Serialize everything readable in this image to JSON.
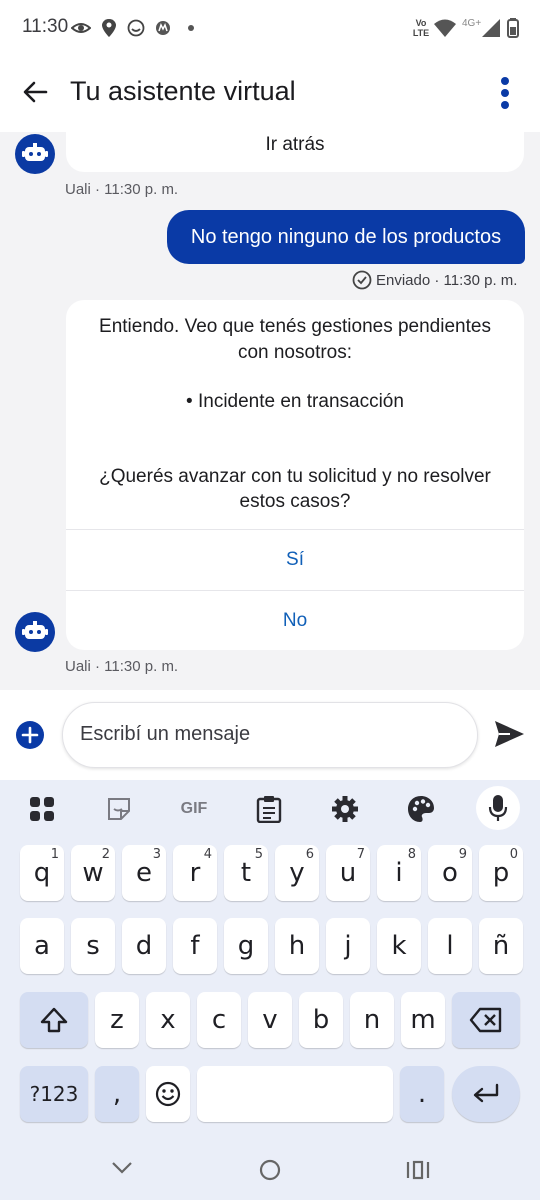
{
  "status_bar": {
    "time": "11:30",
    "icons": [
      "eye-icon",
      "location-icon",
      "smiley-icon",
      "motorola-icon",
      "dot-icon"
    ],
    "right_icons": [
      "volte-icon",
      "wifi-icon",
      "signal-4g-icon",
      "battery-icon"
    ],
    "volte_text": "Vo LTE",
    "net_text": "4G+"
  },
  "header": {
    "title": "Tu asistente virtual"
  },
  "chat": {
    "prev_option": "Ir atrás",
    "bot_meta_1": "Uali · 11:30 p. m.",
    "user_message": "No tengo ninguno de los productos",
    "user_meta": "Enviado · 11:30 p. m.",
    "bot_lines": [
      "Entiendo. Veo que tenés gestiones pendientes",
      "con nosotros:",
      "• Incidente en transacción",
      "¿Querés avanzar con tu solicitud y no resolver",
      "estos casos?"
    ],
    "option_yes": "Sí",
    "option_no": "No",
    "bot_meta_2": "Uali · 11:30 p. m."
  },
  "composer": {
    "placeholder": "Escribí un mensaje"
  },
  "keyboard": {
    "tools": [
      "apps-grid-icon",
      "sticker-icon",
      "gif-icon",
      "clipboard-icon",
      "settings-icon",
      "palette-icon",
      "microphone-icon"
    ],
    "gif_label": "GIF",
    "row1": [
      {
        "k": "q",
        "h": "1"
      },
      {
        "k": "w",
        "h": "2"
      },
      {
        "k": "e",
        "h": "3"
      },
      {
        "k": "r",
        "h": "4"
      },
      {
        "k": "t",
        "h": "5"
      },
      {
        "k": "y",
        "h": "6"
      },
      {
        "k": "u",
        "h": "7"
      },
      {
        "k": "i",
        "h": "8"
      },
      {
        "k": "o",
        "h": "9"
      },
      {
        "k": "p",
        "h": "0"
      }
    ],
    "row2": [
      "a",
      "s",
      "d",
      "f",
      "g",
      "h",
      "j",
      "k",
      "l",
      "ñ"
    ],
    "row3": [
      "z",
      "x",
      "c",
      "v",
      "b",
      "n",
      "m"
    ],
    "symbols": "?123",
    "comma": ",",
    "period": "."
  },
  "colors": {
    "primary": "#0a3aa6",
    "link": "#1160b8",
    "chat_bg": "#f3f3f5",
    "keyboard_bg": "#eaeef8"
  }
}
